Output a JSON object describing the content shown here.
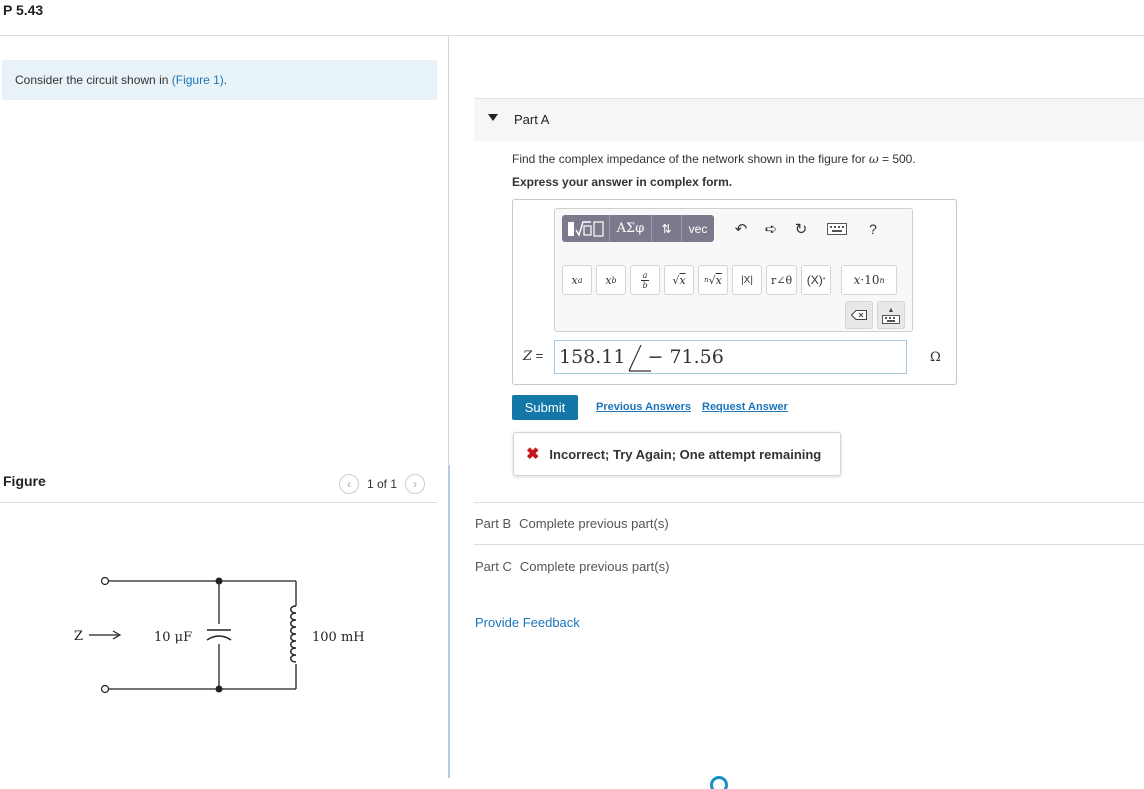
{
  "problem": {
    "title": "P 5.43"
  },
  "intro": {
    "text": "Consider the circuit shown in ",
    "link": "(Figure 1)",
    "suffix": "."
  },
  "figure": {
    "label": "Figure",
    "counter": "1 of 1",
    "prev_icon": "chevron-left-icon",
    "next_icon": "chevron-right-icon",
    "circuit": {
      "z_label": "Z",
      "capacitor_label": "10 μF",
      "inductor_label": "100 mH"
    }
  },
  "part_a": {
    "title": "Part A",
    "question_prefix": "Find the complex impedance of the network shown in the figure for ",
    "omega": "ω",
    "question_suffix": " = 500.",
    "instruction": "Express your answer in complex form.",
    "toolbar": {
      "row1": [
        "templates",
        "ΑΣφ",
        "⇅",
        "vec",
        "undo",
        "redo",
        "reset",
        "keyboard",
        "?"
      ],
      "greek_label": "ΑΣφ",
      "arrows_label": "⇅",
      "vec_label": "vec",
      "help_label": "?",
      "row2": [
        "xᵃ",
        "x_b",
        "a/b",
        "√x",
        "ⁿ√x",
        "|x|",
        "r∠θ",
        "(X)*",
        "x·10ⁿ"
      ],
      "row3": [
        "backspace",
        "keyboard-toggle"
      ]
    },
    "answer": {
      "var": "Z",
      "equals": " =",
      "magnitude": "158.11",
      "angle": "− 71.56",
      "unit": "Ω"
    },
    "submit_label": "Submit",
    "previous_answers_label": "Previous Answers",
    "request_answer_label": "Request Answer",
    "feedback": "Incorrect; Try Again; One attempt remaining"
  },
  "part_b": {
    "name": "Part B",
    "status": "Complete previous part(s)"
  },
  "part_c": {
    "name": "Part C",
    "status": "Complete previous part(s)"
  },
  "provide_feedback_label": "Provide Feedback",
  "colors": {
    "accent": "#1378a8",
    "link": "#1b75bb",
    "error": "#c8151b",
    "intro_bg": "#e8f3f7"
  }
}
